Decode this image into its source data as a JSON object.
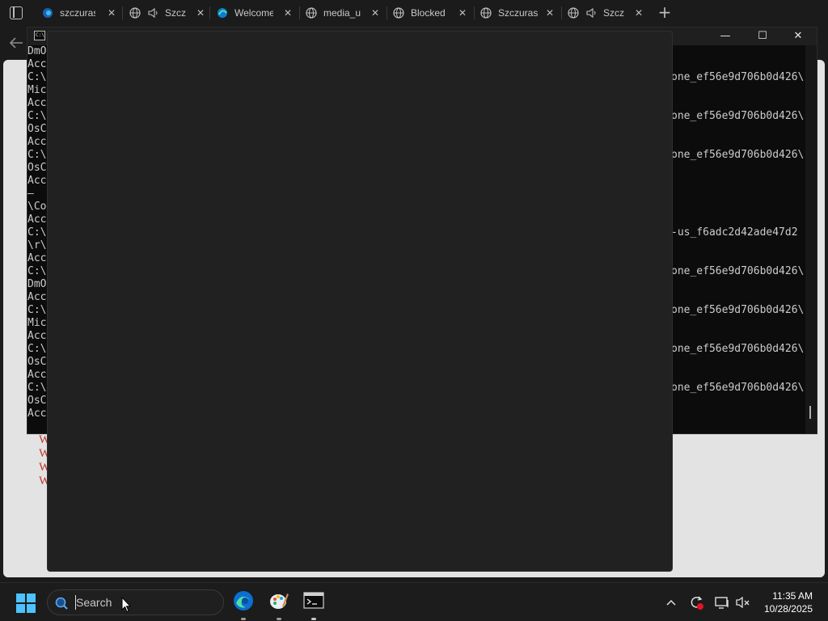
{
  "browser": {
    "tabs": [
      {
        "label": "szczuras",
        "icon": "edge-tab-icon"
      },
      {
        "label": "Szczu",
        "icon": "globe-icon",
        "audio": true
      },
      {
        "label": "Welcome",
        "icon": "edge-logo-icon"
      },
      {
        "label": "media_u",
        "icon": "globe-icon"
      },
      {
        "label": "Blocked",
        "icon": "globe-icon"
      },
      {
        "label": "Szczuras",
        "icon": "globe-icon"
      },
      {
        "label": "Szcz",
        "icon": "globe-icon",
        "audio": true
      }
    ],
    "close_glyph": "✕",
    "new_tab_glyph": "+",
    "content_lines": [
      "W",
      "W",
      "W",
      "W"
    ]
  },
  "cmd": {
    "title_icon_text": "C:\\",
    "left_lines": [
      "DmO",
      "Acc",
      "C:\\",
      "Mic",
      "Acc",
      "C:\\",
      "OsC",
      "Acc",
      "C:\\",
      "OsC",
      "Acc",
      "–",
      "\\Co",
      "Acc",
      "C:\\",
      "\\r\\",
      "Acc",
      "C:\\",
      "DmO",
      "Acc",
      "C:\\",
      "Mic",
      "Acc",
      "C:\\",
      "OsC",
      "Acc",
      "C:\\",
      "OsC",
      "Acc"
    ],
    "right_lines": [
      {
        "row": 2,
        "text": "one_ef56e9d706b0d426\\"
      },
      {
        "row": 5,
        "text": "one_ef56e9d706b0d426\\"
      },
      {
        "row": 8,
        "text": "one_ef56e9d706b0d426\\"
      },
      {
        "row": 14,
        "text": "-us_f6adc2d42ade47d2"
      },
      {
        "row": 17,
        "text": "one_ef56e9d706b0d426\\"
      },
      {
        "row": 20,
        "text": "one_ef56e9d706b0d426\\"
      },
      {
        "row": 23,
        "text": "one_ef56e9d706b0d426\\"
      },
      {
        "row": 26,
        "text": "one_ef56e9d706b0d426\\"
      }
    ],
    "controls": {
      "minimize": "—",
      "maximize": "☐",
      "close": "✕"
    }
  },
  "taskbar": {
    "search_placeholder": "Search",
    "apps": [
      "edge-icon",
      "paint-icon",
      "terminal-icon"
    ],
    "tray": {
      "chevron": "^"
    },
    "clock": {
      "time": "11:35 AM",
      "date": "10/28/2025"
    }
  },
  "colors": {
    "accent": "#4cc2ff",
    "overlay": "#212121",
    "terminal_bg": "#0c0c0c",
    "error_text": "#c0392b"
  }
}
